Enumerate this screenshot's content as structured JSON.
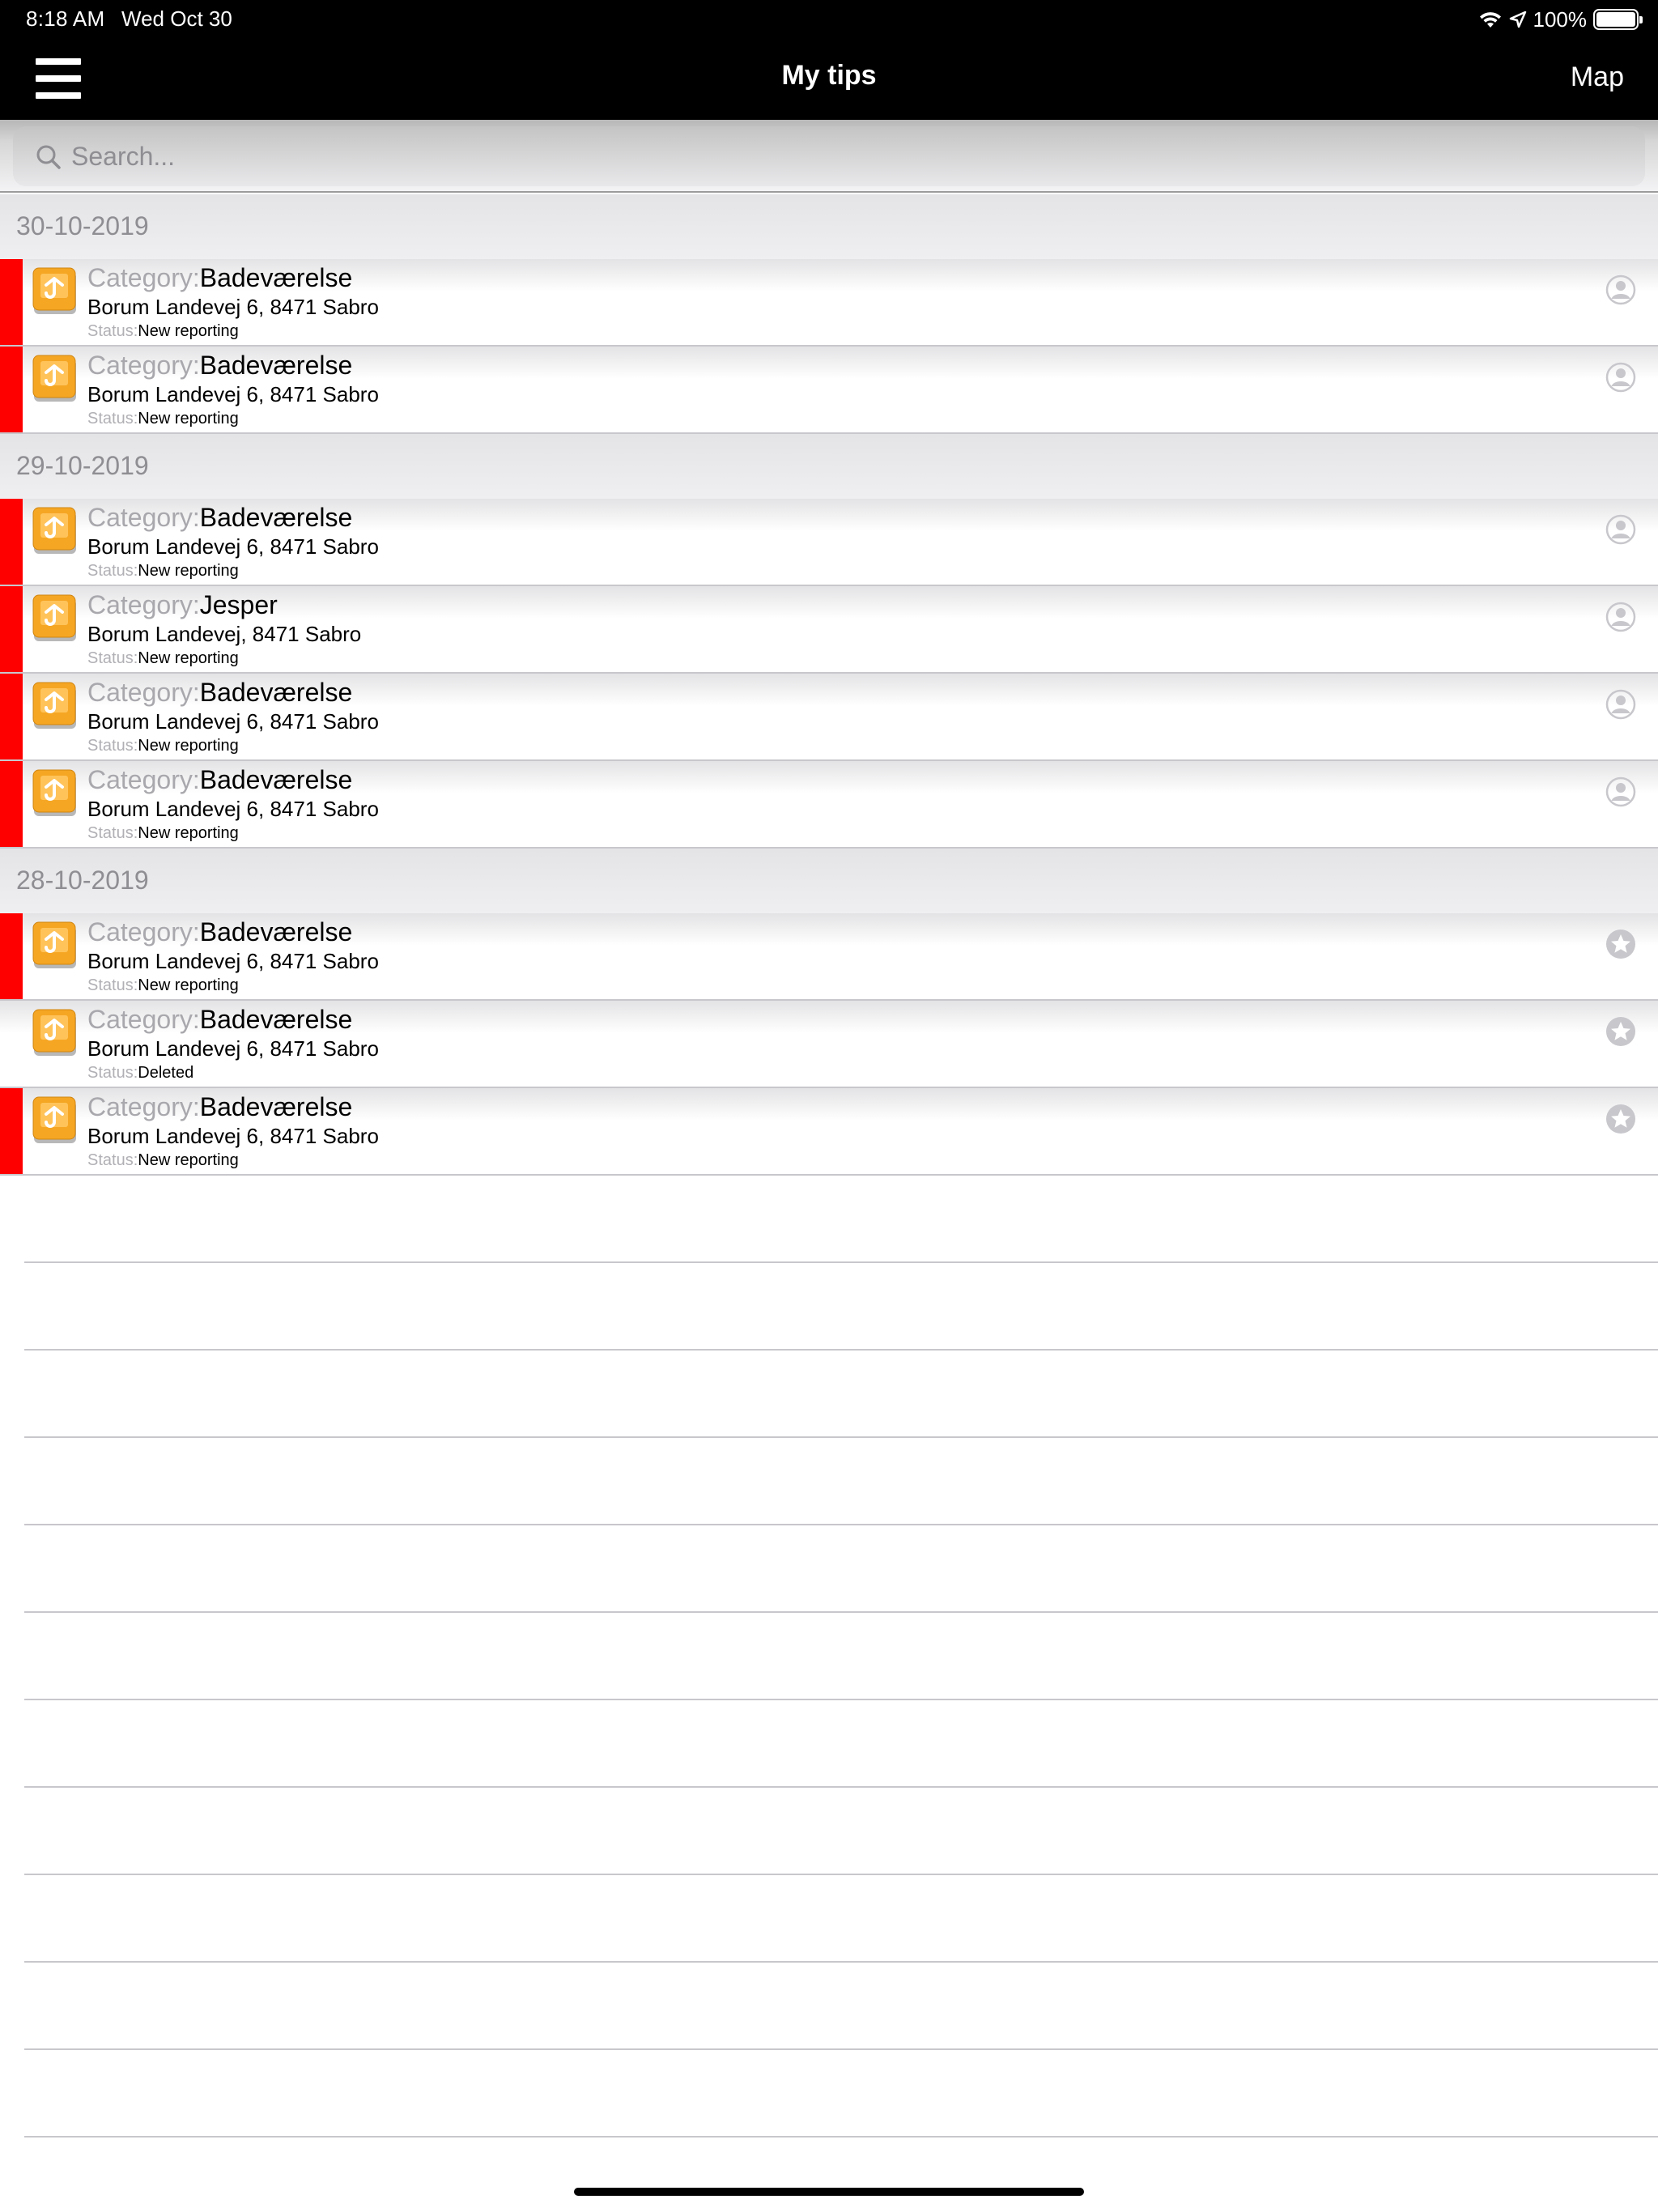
{
  "status_bar": {
    "time": "8:18 AM",
    "date": "Wed Oct 30",
    "battery": "100%",
    "icons": [
      "wifi-icon",
      "location-arrow-icon",
      "battery-icon"
    ]
  },
  "nav": {
    "title": "My tips",
    "right_button": "Map",
    "left_icon": "hamburger-menu-icon"
  },
  "search": {
    "placeholder": "Search...",
    "value": ""
  },
  "colors": {
    "flag": "#ff0000",
    "accent_icon": "#f5a623"
  },
  "sections": [
    {
      "date": "30-10-2019",
      "rows": [
        {
          "flagged": true,
          "category_label": "Category:",
          "category": "Badeværelse",
          "address": "Borum Landevej 6, 8471 Sabro",
          "status_label": "Status:",
          "status": "New reporting",
          "icon": "person-icon"
        },
        {
          "flagged": true,
          "category_label": "Category:",
          "category": "Badeværelse",
          "address": "Borum Landevej 6, 8471 Sabro",
          "status_label": "Status:",
          "status": "New reporting",
          "icon": "person-icon"
        }
      ]
    },
    {
      "date": "29-10-2019",
      "rows": [
        {
          "flagged": true,
          "category_label": "Category:",
          "category": "Badeværelse",
          "address": "Borum Landevej 6, 8471 Sabro",
          "status_label": "Status:",
          "status": "New reporting",
          "icon": "person-icon"
        },
        {
          "flagged": true,
          "category_label": "Category:",
          "category": "Jesper",
          "address": "Borum Landevej, 8471 Sabro",
          "status_label": "Status:",
          "status": "New reporting",
          "icon": "person-icon"
        },
        {
          "flagged": true,
          "category_label": "Category:",
          "category": "Badeværelse",
          "address": "Borum Landevej 6, 8471 Sabro",
          "status_label": "Status:",
          "status": "New reporting",
          "icon": "person-icon"
        },
        {
          "flagged": true,
          "category_label": "Category:",
          "category": "Badeværelse",
          "address": "Borum Landevej 6, 8471 Sabro",
          "status_label": "Status:",
          "status": "New reporting",
          "icon": "person-icon"
        }
      ]
    },
    {
      "date": "28-10-2019",
      "rows": [
        {
          "flagged": true,
          "category_label": "Category:",
          "category": "Badeværelse",
          "address": "Borum Landevej 6, 8471 Sabro",
          "status_label": "Status:",
          "status": "New reporting",
          "icon": "star-icon"
        },
        {
          "flagged": false,
          "category_label": "Category:",
          "category": "Badeværelse",
          "address": "Borum Landevej 6, 8471 Sabro",
          "status_label": "Status:",
          "status": "Deleted",
          "icon": "star-icon"
        },
        {
          "flagged": true,
          "category_label": "Category:",
          "category": "Badeværelse",
          "address": "Borum Landevej 6, 8471 Sabro",
          "status_label": "Status:",
          "status": "New reporting",
          "icon": "star-icon"
        }
      ]
    }
  ]
}
